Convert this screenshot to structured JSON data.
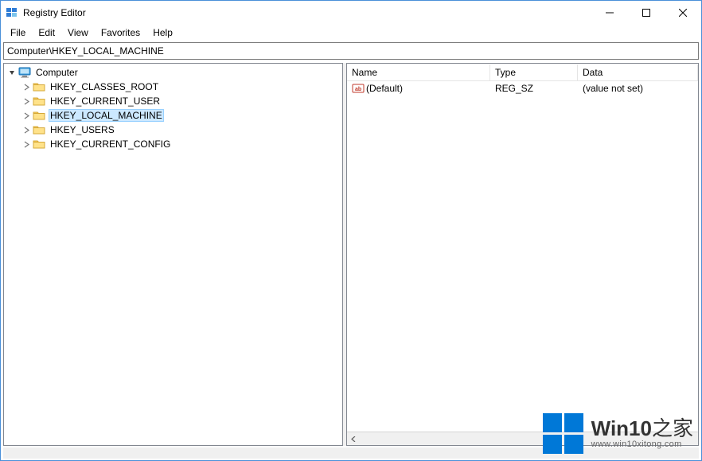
{
  "window": {
    "title": "Registry Editor"
  },
  "menu": {
    "file": "File",
    "edit": "Edit",
    "view": "View",
    "favorites": "Favorites",
    "help": "Help"
  },
  "address": {
    "path": "Computer\\HKEY_LOCAL_MACHINE"
  },
  "tree": {
    "root": "Computer",
    "items": [
      {
        "label": "HKEY_CLASSES_ROOT",
        "selected": false
      },
      {
        "label": "HKEY_CURRENT_USER",
        "selected": false
      },
      {
        "label": "HKEY_LOCAL_MACHINE",
        "selected": true
      },
      {
        "label": "HKEY_USERS",
        "selected": false
      },
      {
        "label": "HKEY_CURRENT_CONFIG",
        "selected": false
      }
    ]
  },
  "list": {
    "headers": {
      "name": "Name",
      "type": "Type",
      "data": "Data"
    },
    "rows": [
      {
        "name": "(Default)",
        "type": "REG_SZ",
        "data": "(value not set)"
      }
    ]
  },
  "watermark": {
    "title_a": "Win10",
    "title_b": "之家",
    "url": "www.win10xitong.com"
  }
}
